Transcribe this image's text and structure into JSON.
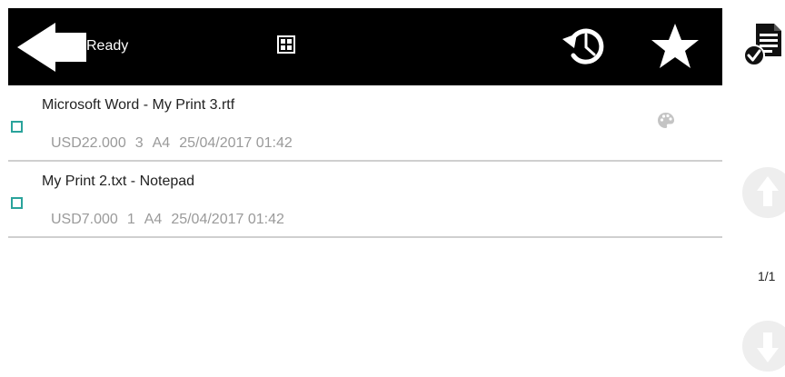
{
  "header": {
    "back_icon": "back-arrow-icon",
    "status": "Ready",
    "view_icon": "grid-view-icon",
    "history_icon": "history-icon",
    "favorite_icon": "star-icon",
    "bar_color": "#000000"
  },
  "jobs": [
    {
      "title": "Microsoft Word - My Print 3.rtf",
      "price": "USD22.000",
      "copies": "3",
      "paper": "A4",
      "datetime": "25/04/2017 01:42",
      "checked": false,
      "color_icon": "palette-icon"
    },
    {
      "title": "My Print 2.txt - Notepad",
      "price": "USD7.000",
      "copies": "1",
      "paper": "A4",
      "datetime": "25/04/2017 01:42",
      "checked": false
    }
  ],
  "sidebar": {
    "print_icon": "print-selected-icon",
    "up_icon": "scroll-up-icon",
    "page_indicator": "1/1",
    "down_icon": "scroll-down-icon"
  },
  "colors": {
    "checkbox_border": "#2aa39b",
    "meta_text": "#9a9a9a",
    "disabled_arrow": "#eeeeee"
  }
}
